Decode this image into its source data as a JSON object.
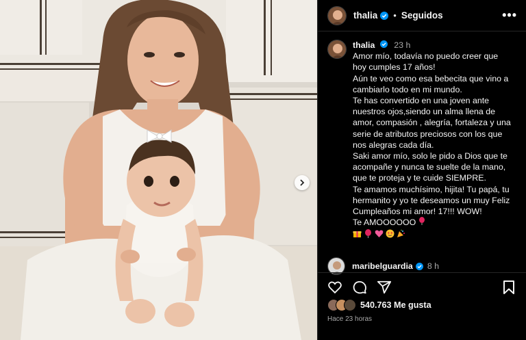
{
  "post": {
    "author": "thalia",
    "follow_status": "Seguidos",
    "more_icon": "more-horizontal-icon",
    "caption": {
      "username": "thalia",
      "time": "23 h",
      "lines": [
        "Amor mío, todavía no puedo creer que",
        "hoy cumples 17 años!",
        "Aún te veo como esa bebecita que vino a",
        "cambiarlo todo en mi mundo.",
        "Te has convertido en una joven ante",
        "nuestros ojos,siendo un alma llena de",
        "amor, compasión , alegría, fortaleza y una",
        "serie de atributos preciosos con los que",
        "nos alegras cada día.",
        "Saki amor mío, solo le pido a Dios que te",
        "acompañe y nunca te suelte de la mano,",
        "que te proteja y te cuide SIEMPRE.",
        "Te amamos muchísimo, hijita! Tu papá, tu",
        "hermanito y yo te deseamos un muy Feliz",
        "Cumpleaños mi amor! 17!!! WOW!",
        "Te AMOOOOOO"
      ],
      "emojis": [
        "gift-emoji",
        "balloon-emoji",
        "sparkling-heart-emoji",
        "smiling-hearts-emoji",
        "party-popper-emoji"
      ]
    },
    "comment": {
      "username": "maribelguardia",
      "time": "8 h"
    },
    "likes": "540.763 Me gusta",
    "posted_ago": "Hace 23 horas"
  },
  "colors": {
    "background": "#000000",
    "text": "#f5f5f5",
    "muted": "#a8a8a8",
    "verified": "#0095f6",
    "divider": "#262626"
  }
}
